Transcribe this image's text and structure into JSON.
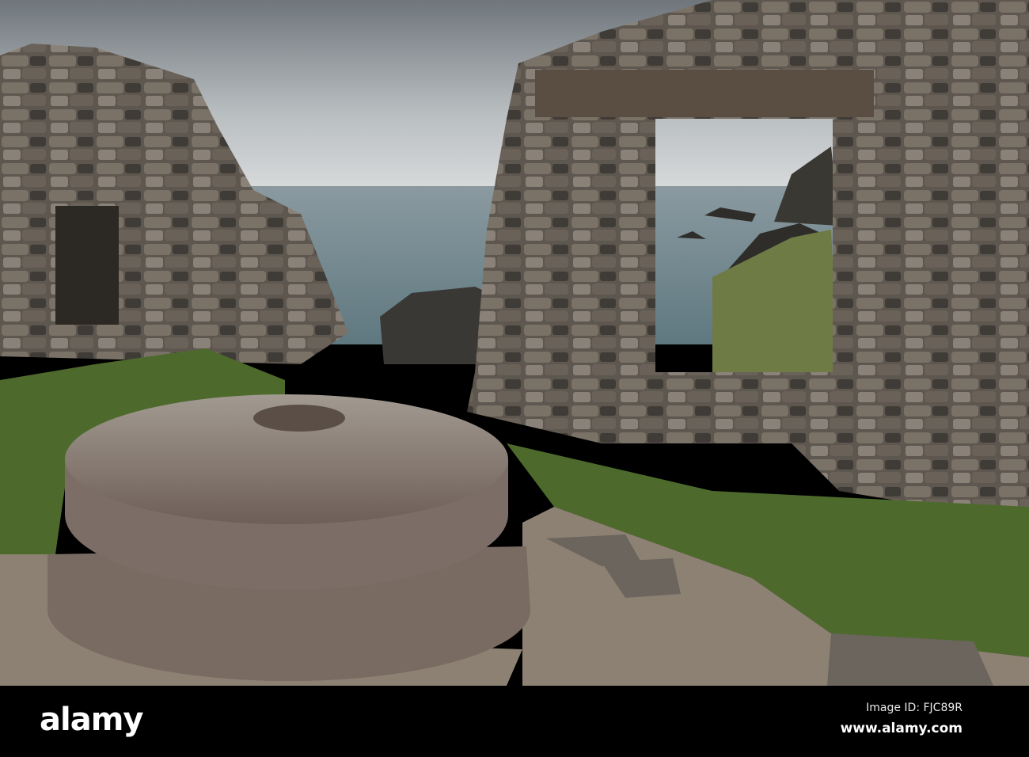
{
  "watermark": {
    "logo": "alamy",
    "image_id": "Image ID: FJC89R",
    "site": "www.alamy.com"
  },
  "colors": {
    "sky": "#c9ccce",
    "sea": "#7e949a",
    "stone": "#6f665c",
    "millstone": "#8a7d73",
    "grass": "#4d6a2c",
    "path": "#8c8172"
  }
}
